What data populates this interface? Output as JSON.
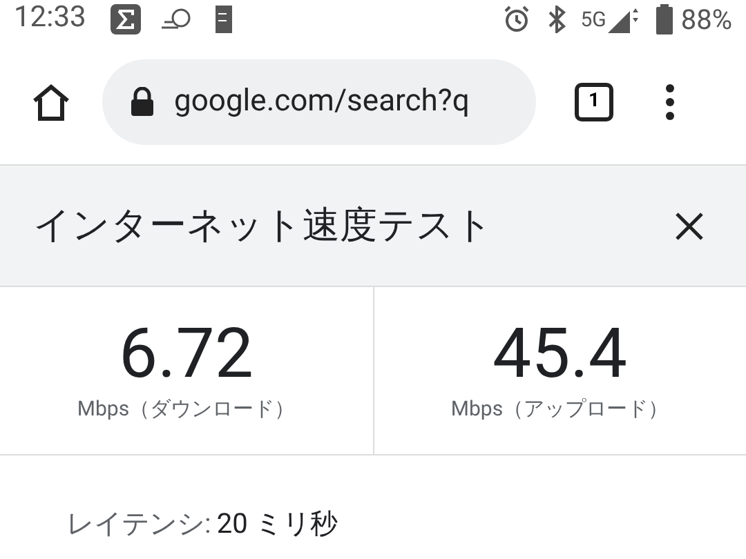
{
  "status_bar": {
    "time": "12:33",
    "network": "5G",
    "battery": "88%"
  },
  "browser": {
    "url": "google.com/search?q",
    "tab_count": "1"
  },
  "card": {
    "title": "インターネット速度テスト",
    "results": [
      {
        "value": "6.72",
        "label": "Mbps（ダウンロード）"
      },
      {
        "value": "45.4",
        "label": "Mbps（アップロード）"
      }
    ],
    "details": [
      {
        "label": "レイテンシ:",
        "value": "20 ミリ秒"
      }
    ]
  }
}
